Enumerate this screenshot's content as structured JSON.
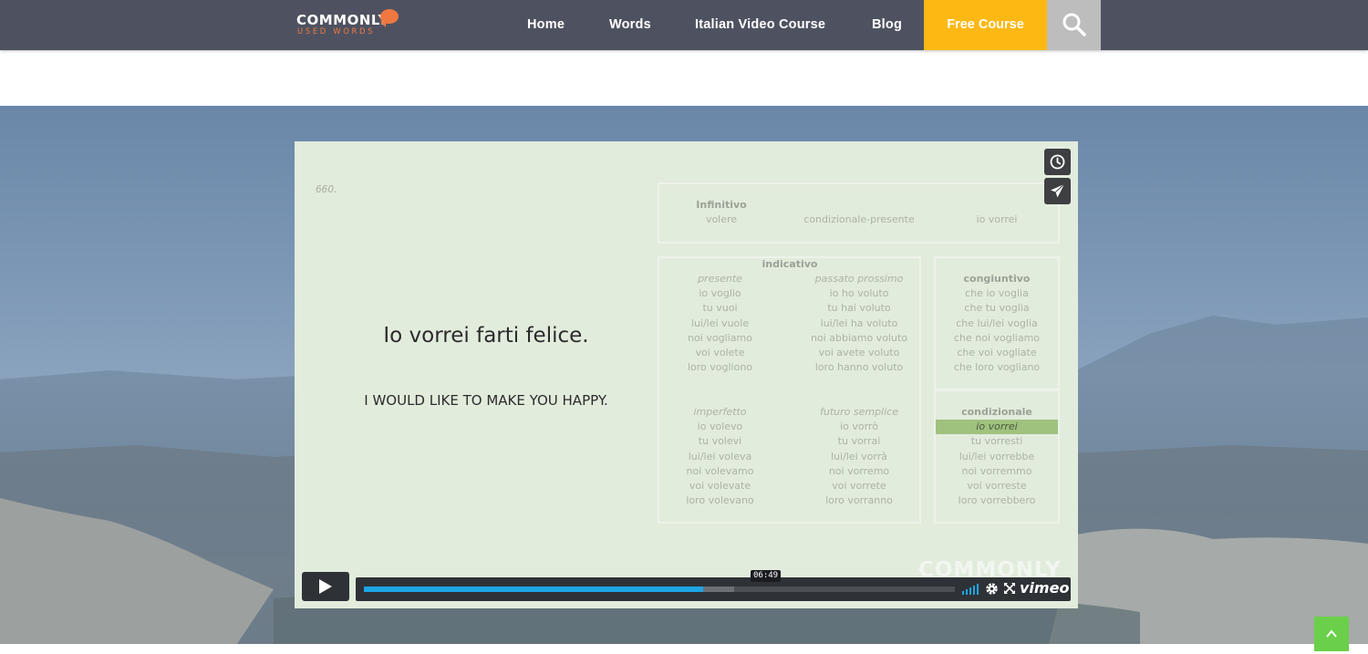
{
  "brand": {
    "name": "COMMONLY",
    "tagline": "USED WORDS",
    "accent_color": "#ee7840"
  },
  "nav": {
    "items": [
      "Home",
      "Words",
      "Italian Video Course",
      "Blog"
    ],
    "cta": "Free Course",
    "cta_color": "#fdb813",
    "search_icon": "search-icon"
  },
  "video": {
    "number": "660.",
    "sentence_it": "Io vorrei farti felice.",
    "sentence_en": "I WOULD LIKE TO MAKE YOU HAPPY.",
    "infinitive": {
      "label": "Infinitivo",
      "verb": "volere",
      "tense": "condizionale-presente",
      "form": "io vorrei"
    },
    "indicativo": {
      "label": "indicativo",
      "presente": {
        "label": "presente",
        "forms": [
          "io voglio",
          "tu vuoi",
          "lui/lei vuole",
          "noi vogliamo",
          "voi volete",
          "loro vogliono"
        ]
      },
      "passato_prossimo": {
        "label": "passato prossimo",
        "forms": [
          "io ho voluto",
          "tu hai voluto",
          "lui/lei ha voluto",
          "noi abbiamo voluto",
          "voi avete voluto",
          "loro hanno voluto"
        ]
      },
      "imperfetto": {
        "label": "imperfetto",
        "forms": [
          "io volevo",
          "tu volevi",
          "lui/lei voleva",
          "noi volevamo",
          "voi volevate",
          "loro volevano"
        ]
      },
      "futuro_semplice": {
        "label": "futuro semplice",
        "forms": [
          "io vorrò",
          "tu vorrai",
          "lui/lei vorrà",
          "noi vorremo",
          "voi vorrete",
          "loro vorranno"
        ]
      }
    },
    "congiuntivo": {
      "label": "congiuntivo",
      "forms": [
        "che io voglia",
        "che tu voglia",
        "che lui/lei voglia",
        "che noi vogliamo",
        "che voi vogliate",
        "che loro vogliano"
      ]
    },
    "condizionale": {
      "label": "condizionale",
      "highlighted": "io vorrei",
      "forms": [
        "tu vorresti",
        "lui/lei vorrebbe",
        "noi vorremmo",
        "voi vorreste",
        "loro vorrebbero"
      ]
    },
    "watermark": "COMMONLY",
    "player": {
      "time": "06:49",
      "played_fraction": 0.574,
      "loaded_fraction": 0.627,
      "brand": "vimeo",
      "progress_color": "#1ea5e4"
    }
  }
}
